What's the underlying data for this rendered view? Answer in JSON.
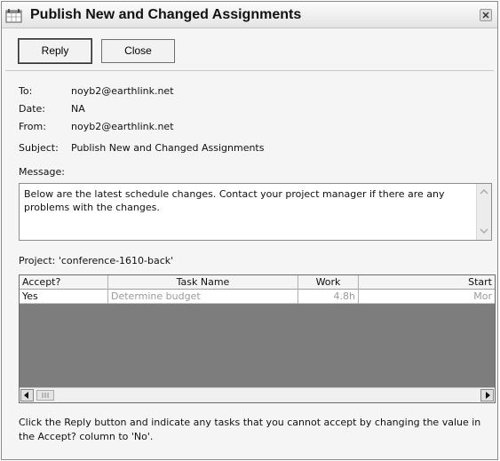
{
  "window": {
    "title": "Publish New and Changed Assignments"
  },
  "toolbar": {
    "reply_label": "Reply",
    "close_label": "Close"
  },
  "header": {
    "to_label": "To:",
    "to_value": "noyb2@earthlink.net",
    "date_label": "Date:",
    "date_value": "NA",
    "from_label": "From:",
    "from_value": "noyb2@earthlink.net",
    "subject_label": "Subject:",
    "subject_value": "Publish New and Changed Assignments"
  },
  "message": {
    "label": "Message:",
    "text": "Below are the latest schedule changes. Contact your project manager if there are any problems with the changes."
  },
  "project": {
    "label": "Project: 'conference-1610-back'"
  },
  "grid": {
    "columns": [
      "Accept?",
      "Task Name",
      "Work",
      "Start"
    ],
    "rows": [
      [
        "Yes",
        "Determine budget",
        "4.8h",
        "Mor"
      ]
    ]
  },
  "footer": {
    "text": "Click the Reply button and indicate any tasks that you cannot accept by changing the value in the Accept? column to 'No'."
  },
  "colors": {
    "grid_empty": "#7d7d7d",
    "dim_text": "#9a9a9a"
  },
  "icons": [
    "calendar-icon",
    "close-icon",
    "scroll-up-arrow-icon",
    "scroll-down-arrow-icon",
    "scroll-left-arrow-icon",
    "scroll-right-arrow-icon"
  ]
}
